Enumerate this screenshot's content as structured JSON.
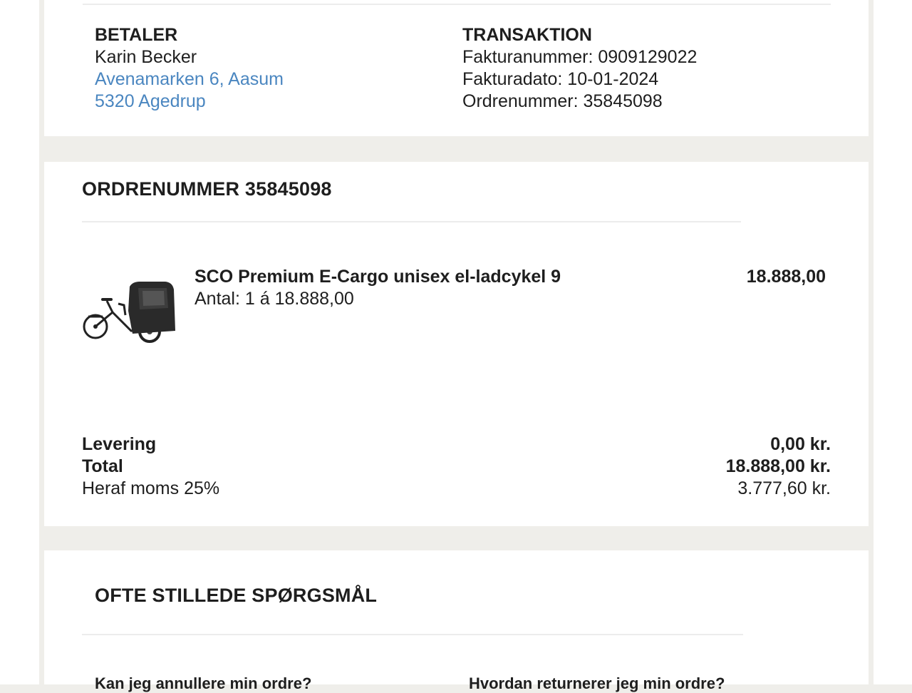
{
  "billing": {
    "payer_heading": "BETALER",
    "payer_name": "Karin Becker",
    "payer_street": "Avenamarken 6, Aasum",
    "payer_city": "5320 Agedrup",
    "transaction_heading": "TRANSAKTION",
    "invoice_number": "Fakturanummer: 0909129022",
    "invoice_date": "Fakturadato: 10-01-2024",
    "order_number": "Ordrenummer: 35845098"
  },
  "order": {
    "heading": "ORDRENUMMER 35845098",
    "item": {
      "name": "SCO Premium E-Cargo unisex el-ladcykel 9",
      "quantity": "Antal: 1 á 18.888,00",
      "price": "18.888,00",
      "image_icon": "cargo-bike-image"
    },
    "summary": {
      "delivery_label": "Levering",
      "delivery_value": "0,00 kr.",
      "total_label": "Total",
      "total_value": "18.888,00 kr.",
      "vat_label": "Heraf moms 25%",
      "vat_value": "3.777,60 kr."
    }
  },
  "faq": {
    "heading": "OFTE STILLEDE SPØRGSMÅL",
    "q1": "Kan jeg annullere min ordre?",
    "q2": "Hvordan returnerer jeg min ordre?"
  },
  "colors": {
    "page_background": "#efeeea",
    "link": "#4a86c0",
    "text": "#1e1e1e"
  }
}
